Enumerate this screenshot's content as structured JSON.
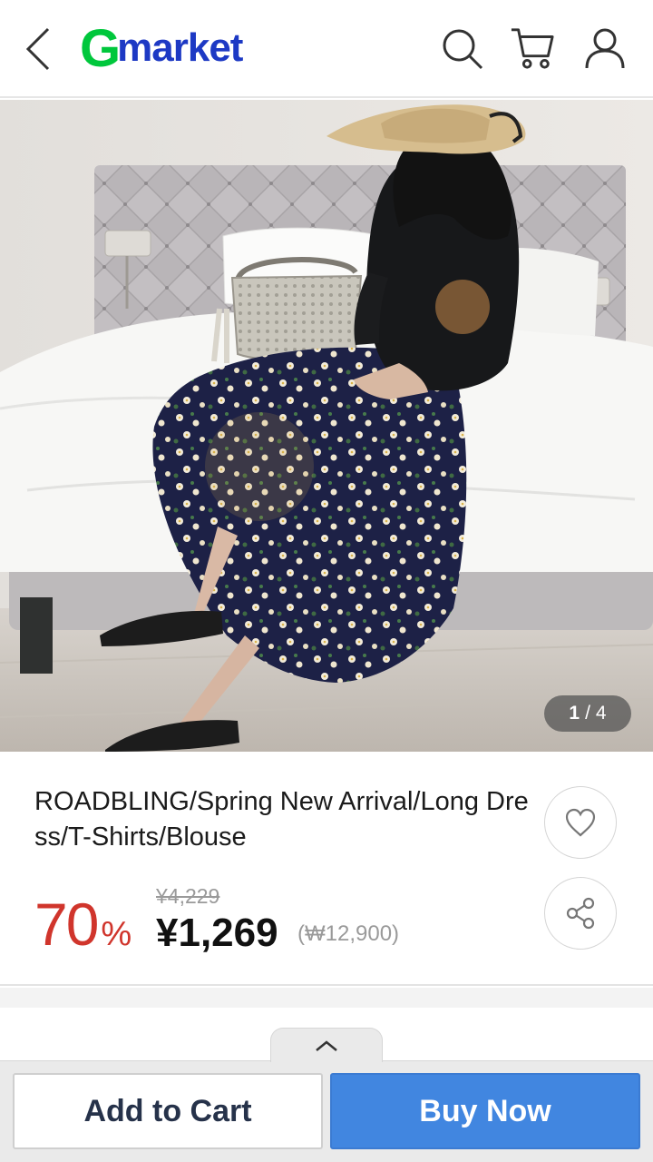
{
  "header": {
    "logo_g": "G",
    "logo_text": "market",
    "icons": [
      "back-icon",
      "search-icon",
      "cart-icon",
      "user-icon"
    ],
    "brand_green": "#00c73c",
    "brand_blue": "#1d39c4"
  },
  "gallery": {
    "current": "1",
    "separator": "/",
    "total": "4"
  },
  "product": {
    "title": "ROADBLING/Spring New Arrival/Long Dress/T-Shirts/Blouse",
    "discount_value": "70",
    "discount_unit": "%",
    "original_price": "¥4,229",
    "price": "¥1,269",
    "price_won": "(₩12,900)",
    "discount_color": "#d0352c"
  },
  "actions": {
    "wishlist_icon": "heart-icon",
    "share_icon": "share-icon",
    "add_to_cart": "Add to Cart",
    "buy_now": "Buy Now",
    "buy_color": "#4186e0"
  }
}
